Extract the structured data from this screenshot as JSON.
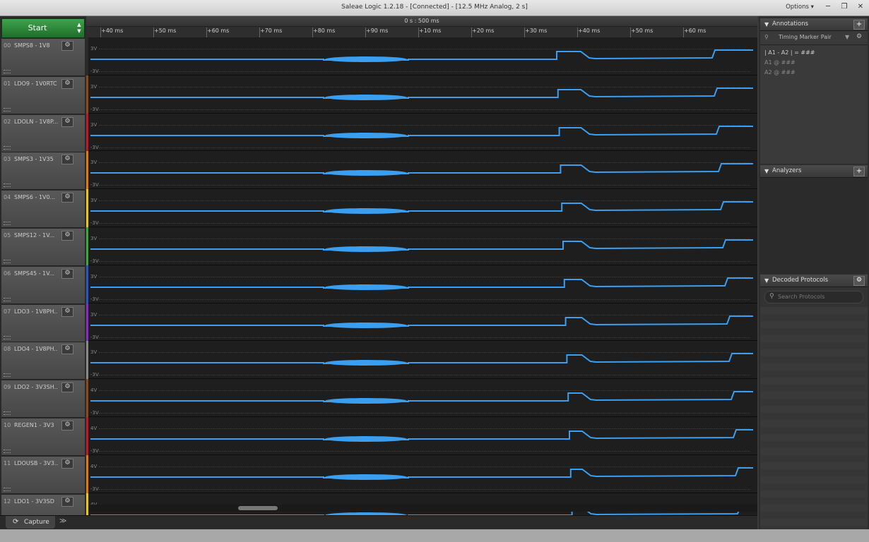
{
  "window": {
    "title": "Saleae Logic 1.2.18 - [Connected] - [12.5 MHz Analog, 2 s]",
    "options_label": "Options ▾",
    "minimize": "─",
    "restore": "❐",
    "close": "✕"
  },
  "start": {
    "label": "Start"
  },
  "ruler": {
    "center_label": "0 s : 500 ms",
    "ticks": [
      "+40 ms",
      "+50 ms",
      "+60 ms",
      "+70 ms",
      "+80 ms",
      "+90 ms",
      "+10 ms",
      "+20 ms",
      "+30 ms",
      "+40 ms",
      "+50 ms",
      "+60 ms"
    ]
  },
  "channels": [
    {
      "num": "00",
      "name": "SMPS8 - 1V8",
      "color": "#2a2a2a",
      "vtop": "3V",
      "vbot": "-3V"
    },
    {
      "num": "01",
      "name": "LDO9 - 1V0RTC",
      "color": "#8a4a1a",
      "vtop": "3V",
      "vbot": "-3V"
    },
    {
      "num": "02",
      "name": "LDOLN - 1V8P...",
      "color": "#c0182a",
      "vtop": "3V",
      "vbot": "-3V"
    },
    {
      "num": "03",
      "name": "SMPS3 - 1V35",
      "color": "#e07a10",
      "vtop": "3V",
      "vbot": "-3V"
    },
    {
      "num": "04",
      "name": "SMPS6 - 1V0...",
      "color": "#e8c814",
      "vtop": "3V",
      "vbot": "-3V"
    },
    {
      "num": "05",
      "name": "SMPS12 - 1V...",
      "color": "#3aa83a",
      "vtop": "3V",
      "vbot": "-3V"
    },
    {
      "num": "06",
      "name": "SMPS45 - 1V...",
      "color": "#2a55c8",
      "vtop": "3V",
      "vbot": "-3V"
    },
    {
      "num": "07",
      "name": "LDO3 - 1V8PH...",
      "color": "#8a2ac8",
      "vtop": "3V",
      "vbot": "-3V"
    },
    {
      "num": "08",
      "name": "LDO4 - 1V8PH...",
      "color": "#888888",
      "vtop": "3V",
      "vbot": "-3V"
    },
    {
      "num": "09",
      "name": "LDO2 - 3V3SH...",
      "color": "#8a4a1a",
      "vtop": "4V",
      "vbot": "-3V"
    },
    {
      "num": "10",
      "name": "REGEN1 - 3V3",
      "color": "#c0182a",
      "vtop": "4V",
      "vbot": "-3V"
    },
    {
      "num": "11",
      "name": "LDOUSB - 3V3...",
      "color": "#e07a10",
      "vtop": "4V",
      "vbot": "-3V"
    },
    {
      "num": "12",
      "name": "LDO1 - 3V3SD",
      "color": "#e8c814",
      "vtop": "4V",
      "vbot": ""
    }
  ],
  "bottom": {
    "capture_label": "Capture",
    "more": "≫"
  },
  "annotations": {
    "header": "Annotations",
    "marker": "Timing Marker Pair",
    "diff_text": "|  A1  -  A2  |  =  ###",
    "a1_text": "A1  @  ###",
    "a2_text": "A2  @  ###"
  },
  "analyzers": {
    "header": "Analyzers"
  },
  "decoded": {
    "header": "Decoded Protocols",
    "search_placeholder": "Search Protocols"
  },
  "icons": {
    "gear": "⚙",
    "plus": "+",
    "triangle": "▼",
    "search": "⚲"
  },
  "accent": {
    "wave": "#3a9ff0",
    "start": "#2e8a3c"
  }
}
